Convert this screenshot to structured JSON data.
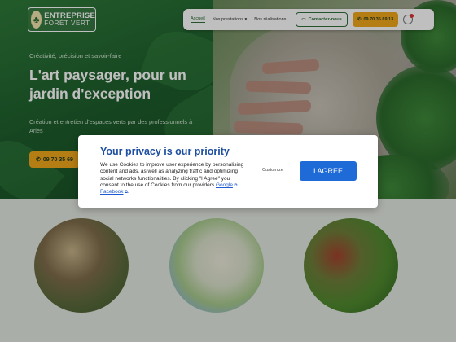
{
  "header": {
    "logo": {
      "line1": "ENTREPRISE",
      "line2": "FORÊT VERT"
    },
    "nav": [
      {
        "label": "Accueil",
        "active": true
      },
      {
        "label": "Nos prestations",
        "has_dropdown": true
      },
      {
        "label": "Nos réalisations",
        "active": false
      }
    ],
    "contact_button": "Contactez-nous",
    "phone_button": "09 70 35 69 13"
  },
  "hero": {
    "tagline": "Créativité, précision et savoir-faire",
    "headline": "L'art paysager, pour un jardin d'exception",
    "subtext": "Création et entretien d'espaces verts par des professionnels à Arles",
    "phone_cta": "09 70 35 69"
  },
  "privacy": {
    "title": "Your privacy is our priority",
    "body": "We use Cookies to improve user experience by personalising content and ads, as well as analyzing traffic and optimizing social networks functionalities. By clicking \"I Agree\" you consent to the use of Cookies from our providers",
    "provider_google": "Google",
    "separator": " ",
    "provider_facebook": "Facebook",
    "end": ".",
    "customize_label": "Customize",
    "agree_label": "I AGREE"
  },
  "colors": {
    "brand_green": "#2f6f3a",
    "accent_yellow": "#f2a81d",
    "modal_title_blue": "#1f4fa0",
    "agree_blue": "#1e6ad6"
  }
}
